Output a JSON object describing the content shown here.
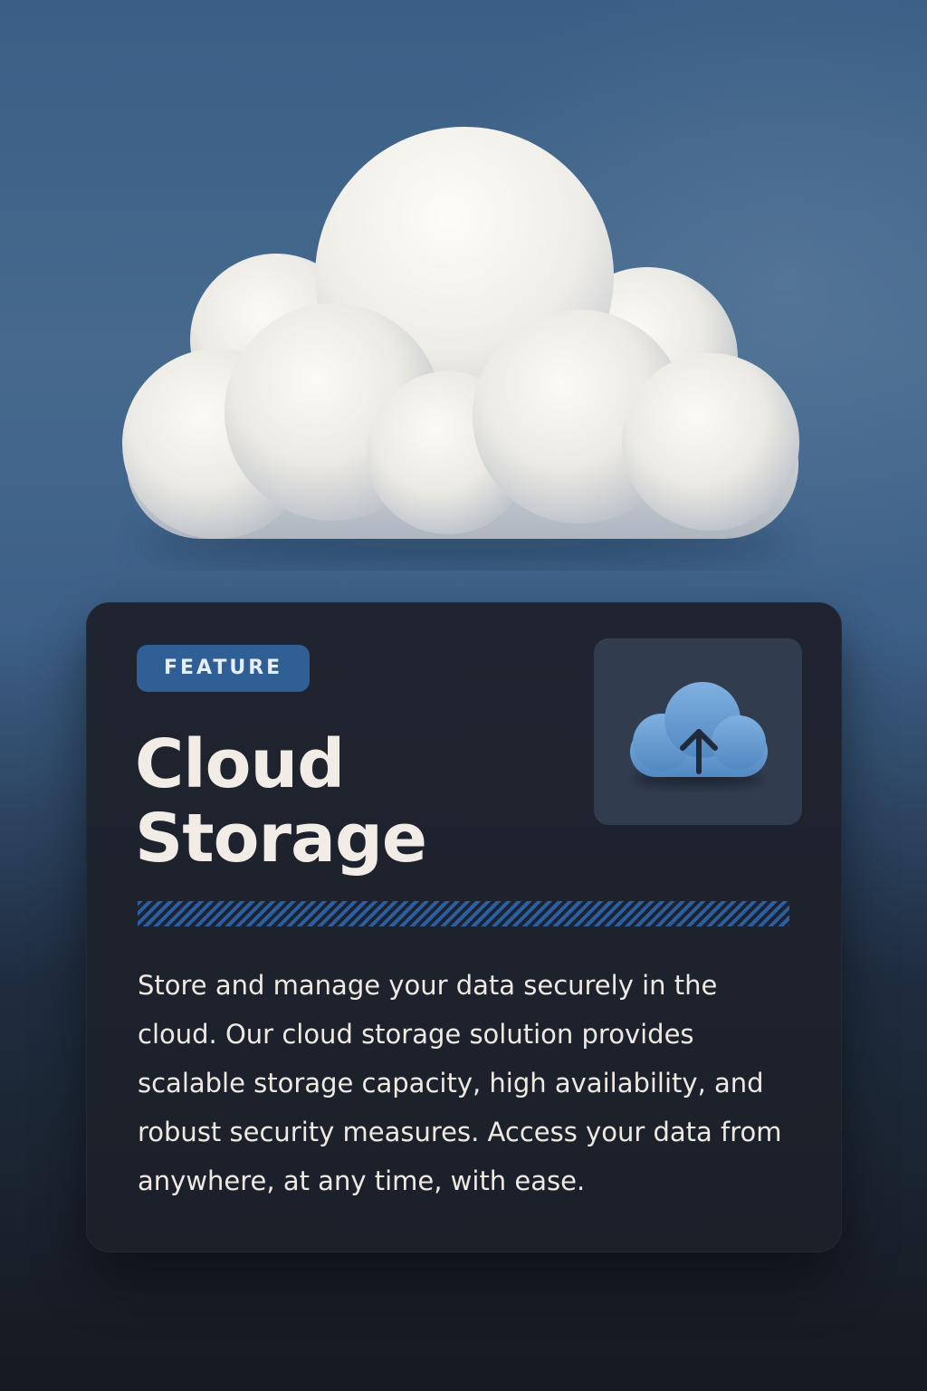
{
  "card": {
    "badge": "FEATURE",
    "title_line1": "Cloud",
    "title_line2": "Storage",
    "description": "Store and manage your data securely in the cloud. Our cloud storage solution provides scalable storage capacity, high availability, and robust security measures. Access your data from anywhere, at any time, with ease.",
    "icon": "cloud-upload-icon"
  },
  "hero": {
    "illustration": "cloud-icon"
  },
  "colors": {
    "accent": "#2f5f94",
    "icon_blue": "#6b9fd4",
    "card_bg": "#1f2430",
    "text_light": "#f1ede6"
  }
}
